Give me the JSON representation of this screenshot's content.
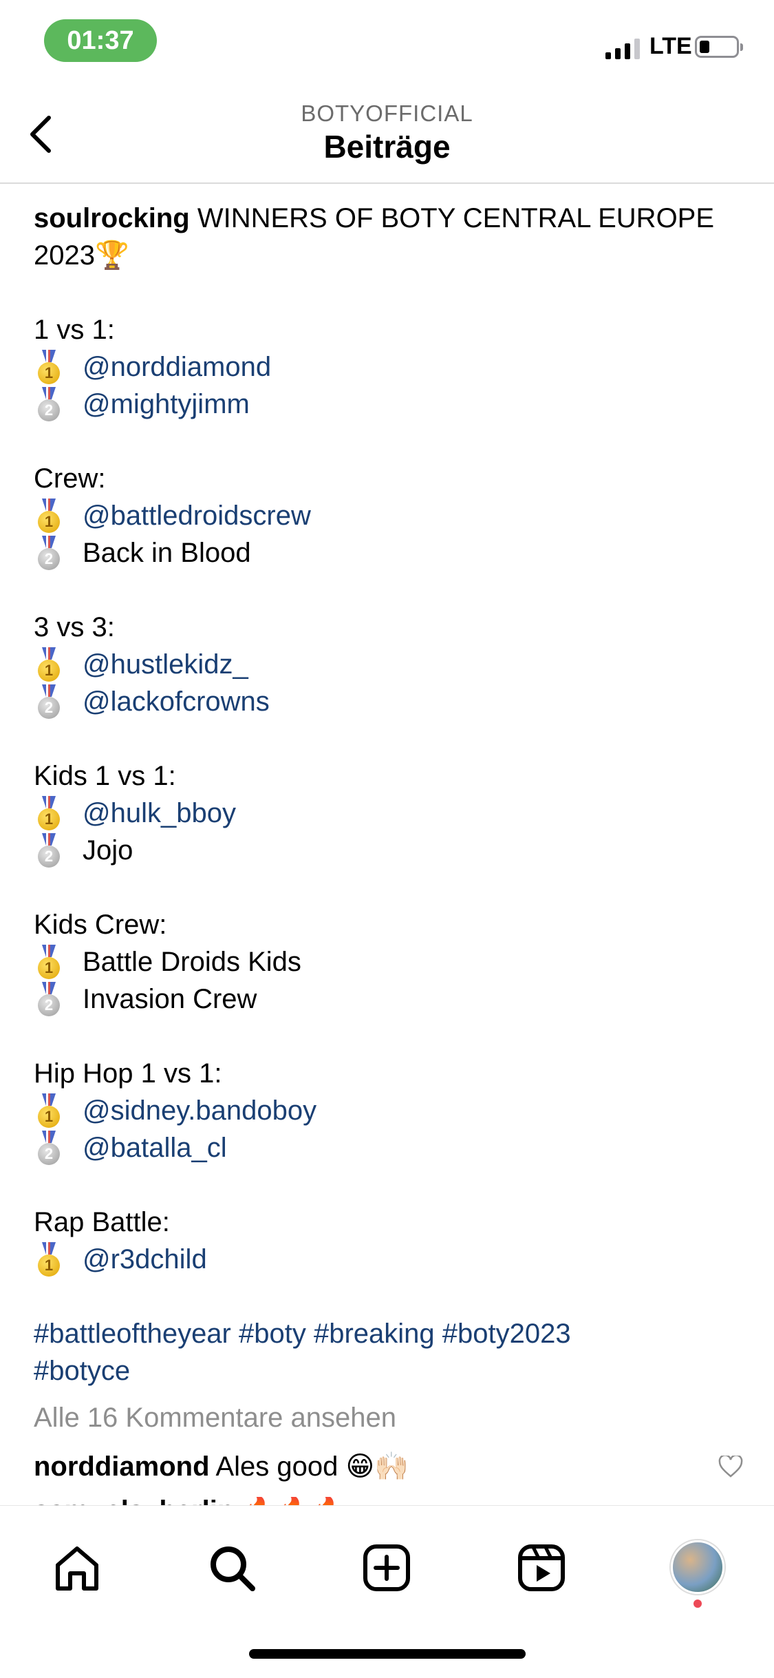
{
  "status_bar": {
    "time": "01:37",
    "network": "LTE"
  },
  "header": {
    "account": "BOTYOFFICIAL",
    "title": "Beiträge"
  },
  "post": {
    "username": "soulrocking",
    "caption_title": "WINNERS OF BOTY CENTRAL EUROPE 2023",
    "caption_emoji": "🏆",
    "sections": [
      {
        "title": "1 vs 1:",
        "entries": [
          {
            "medal": "1",
            "text": "@norddiamond",
            "is_link": true
          },
          {
            "medal": "2",
            "text": "@mightyjimm",
            "is_link": true
          }
        ]
      },
      {
        "title": "Crew:",
        "entries": [
          {
            "medal": "1",
            "text": "@battledroidscrew",
            "is_link": true
          },
          {
            "medal": "2",
            "text": "Back in Blood",
            "is_link": false
          }
        ]
      },
      {
        "title": "3 vs 3:",
        "entries": [
          {
            "medal": "1",
            "text": "@hustlekidz_",
            "is_link": true
          },
          {
            "medal": "2",
            "text": "@lackofcrowns",
            "is_link": true
          }
        ]
      },
      {
        "title": "Kids 1 vs 1:",
        "entries": [
          {
            "medal": "1",
            "text": "@hulk_bboy",
            "is_link": true
          },
          {
            "medal": "2",
            "text": "Jojo",
            "is_link": false
          }
        ]
      },
      {
        "title": "Kids Crew:",
        "entries": [
          {
            "medal": "1",
            "text": "Battle Droids Kids",
            "is_link": false
          },
          {
            "medal": "2",
            "text": "Invasion Crew",
            "is_link": false
          }
        ]
      },
      {
        "title": "Hip Hop 1 vs 1:",
        "entries": [
          {
            "medal": "1",
            "text": "@sidney.bandoboy",
            "is_link": true
          },
          {
            "medal": "2",
            "text": "@batalla_cl",
            "is_link": true
          }
        ]
      },
      {
        "title": "Rap Battle:",
        "entries": [
          {
            "medal": "1",
            "text": "@r3dchild",
            "is_link": true
          }
        ]
      }
    ],
    "hashtags_line1": "#battleoftheyear #boty #breaking #boty2023",
    "hashtags_line2": "#botyce",
    "view_comments": "Alle 16 Kommentare ansehen",
    "comments": [
      {
        "user": "norddiamond",
        "text": "Ales good 😁🙌🏻"
      },
      {
        "user": "samuels_berlin",
        "text": "🔥🔥🔥"
      }
    ]
  },
  "nav": {
    "items": [
      "home-icon",
      "search-icon",
      "new-post-icon",
      "reels-icon",
      "profile-avatar"
    ],
    "notification_color": "#ed4956"
  }
}
